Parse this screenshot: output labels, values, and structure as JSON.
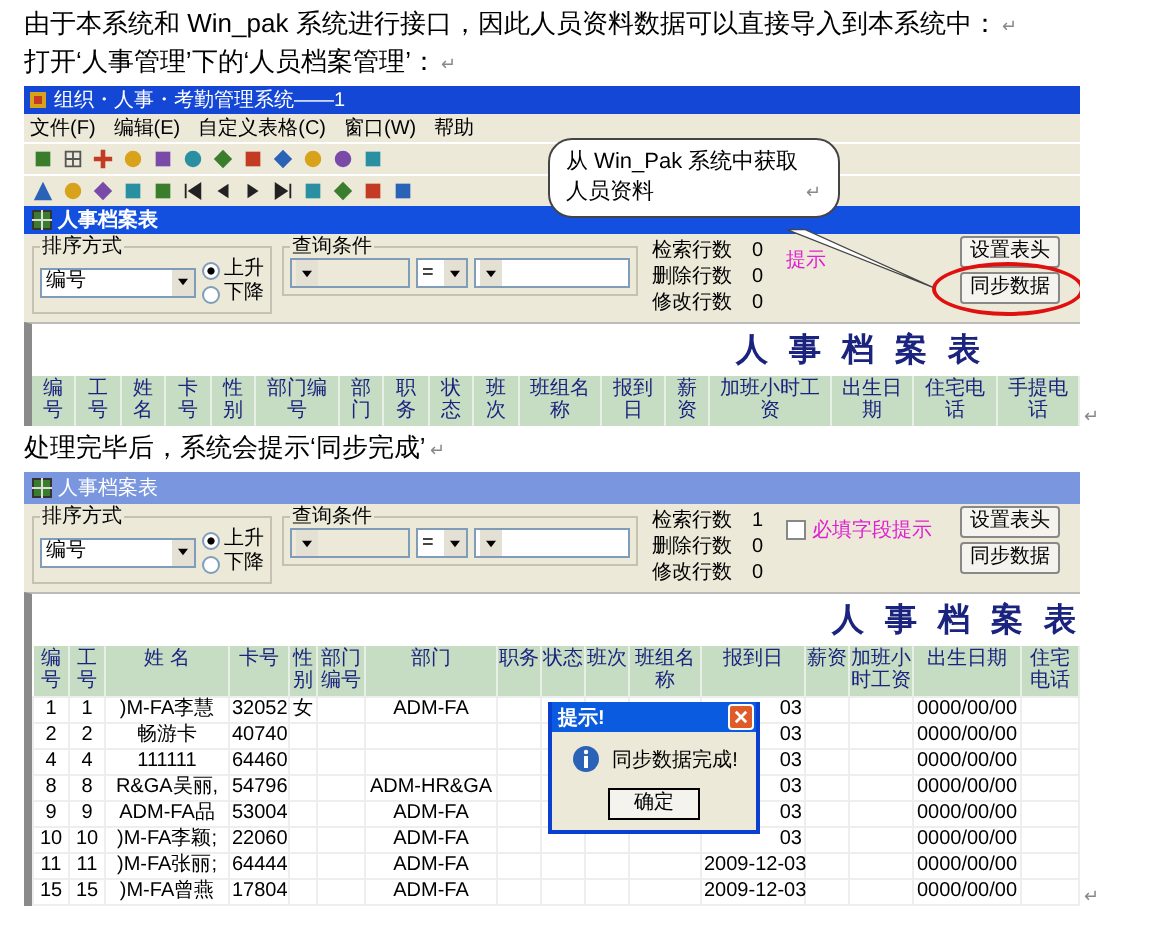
{
  "paragraphs": [
    {
      "text": "由于本系统和 Win_pak 系统进行接口，因此人员资料数据可以直接导入到本系统中：",
      "mark": "↵"
    },
    {
      "text": "打开‘人事管理’下的‘人员档案管理’：",
      "mark": "↵"
    }
  ],
  "figure_1": {
    "app_title": "组织・人事・考勤管理系统——1",
    "menu": [
      "文件(F)",
      "编辑(E)",
      "自定义表格(C)",
      "窗口(W)",
      "帮助"
    ],
    "window_title": "人事档案表",
    "filter": {
      "sort_label": "排序方式",
      "sort_value": "编号",
      "sort_orders": [
        {
          "label": "上升",
          "selected": true
        },
        {
          "label": "下降",
          "selected": false
        }
      ],
      "query_label": "查询条件",
      "operator": "=",
      "stats": [
        {
          "label": "检索行数",
          "value": "0"
        },
        {
          "label": "删除行数",
          "value": "0"
        },
        {
          "label": "修改行数",
          "value": "0"
        }
      ],
      "required_hint": {
        "label": "提示"
      },
      "buttons": [
        {
          "label": "设置表头",
          "highlighted": false
        },
        {
          "label": "同步数据",
          "highlighted": true
        }
      ]
    },
    "report_title": "人 事 档 案 表",
    "columns": [
      {
        "label": "编号"
      },
      {
        "label": "工号"
      },
      {
        "label": "姓名"
      },
      {
        "label": "卡号"
      },
      {
        "label": "性别"
      },
      {
        "label": "部门编号"
      },
      {
        "label": "部门"
      },
      {
        "label": "职务"
      },
      {
        "label": "状态"
      },
      {
        "label": "班次"
      },
      {
        "label": "班组名称"
      },
      {
        "label": "报到日"
      },
      {
        "label": "薪资"
      },
      {
        "label": "加班小时工资"
      },
      {
        "label": "出生日期"
      },
      {
        "label": "住宅电话"
      },
      {
        "label": "手提电话"
      }
    ],
    "callout": {
      "text": "从 Win_Pak 系统中获取人员资料",
      "mark": "↵"
    },
    "end_mark": "↵"
  },
  "paragraph_2": {
    "text": "处理完毕后，系统会提示‘同步完成’",
    "mark": "↵"
  },
  "figure_2": {
    "window_title": "人事档案表",
    "filter": {
      "sort_label": "排序方式",
      "sort_value": "编号",
      "sort_orders": [
        {
          "label": "上升",
          "selected": true
        },
        {
          "label": "下降",
          "selected": false
        }
      ],
      "query_label": "查询条件",
      "operator": "=",
      "stats": [
        {
          "label": "检索行数",
          "value": "1"
        },
        {
          "label": "删除行数",
          "value": "0"
        },
        {
          "label": "修改行数",
          "value": "0"
        }
      ],
      "required_hint": {
        "label": "必填字段提示",
        "checked": false
      },
      "buttons": [
        {
          "label": "设置表头",
          "highlighted": false
        },
        {
          "label": "同步数据",
          "highlighted": false
        }
      ]
    },
    "report_title": "人 事 档 案 表",
    "columns": [
      {
        "label": "编号"
      },
      {
        "label": "工号"
      },
      {
        "label": "姓 名"
      },
      {
        "label": "卡号"
      },
      {
        "label": "性别"
      },
      {
        "label": "部门编号"
      },
      {
        "label": "部门"
      },
      {
        "label": "职务"
      },
      {
        "label": "状态"
      },
      {
        "label": "班次"
      },
      {
        "label": "班组名称"
      },
      {
        "label": "报到日"
      },
      {
        "label": "薪资"
      },
      {
        "label": "加班小时工资"
      },
      {
        "label": "出生日期"
      },
      {
        "label": "住宅电话"
      }
    ],
    "rows": [
      {
        "no": "1",
        "emp_no": "1",
        "name": ")M-FA李慧",
        "card": "32052",
        "sex": "女",
        "dept": "ADM-FA",
        "report_date": "03",
        "birth": "0000/00/00"
      },
      {
        "no": "2",
        "emp_no": "2",
        "name": "畅游卡",
        "card": "40740",
        "report_date": "03",
        "birth": "0000/00/00"
      },
      {
        "no": "4",
        "emp_no": "4",
        "name": "111111",
        "card": "64460",
        "report_date": "03",
        "birth": "0000/00/00"
      },
      {
        "no": "8",
        "emp_no": "8",
        "name": "R&GA吴丽,",
        "card": "54796",
        "dept": "ADM-HR&GA",
        "report_date": "03",
        "birth": "0000/00/00"
      },
      {
        "no": "9",
        "emp_no": "9",
        "name": "ADM-FA品",
        "card": "53004",
        "dept": "ADM-FA",
        "report_date": "03",
        "birth": "0000/00/00"
      },
      {
        "no": "10",
        "emp_no": "10",
        "name": ")M-FA李颖;",
        "card": "22060",
        "dept": "ADM-FA",
        "report_date": "03",
        "birth": "0000/00/00"
      },
      {
        "no": "11",
        "emp_no": "11",
        "name": ")M-FA张丽;",
        "card": "64444",
        "dept": "ADM-FA",
        "report_date": "2009-12-03",
        "birth": "0000/00/00"
      },
      {
        "no": "15",
        "emp_no": "15",
        "name": ")M-FA曾燕",
        "card": "17804",
        "dept": "ADM-FA",
        "report_date": "2009-12-03",
        "birth": "0000/00/00"
      }
    ],
    "dialog": {
      "title": "提示!",
      "message": "同步数据完成!",
      "button": "确定"
    },
    "end_mark": "↵"
  }
}
